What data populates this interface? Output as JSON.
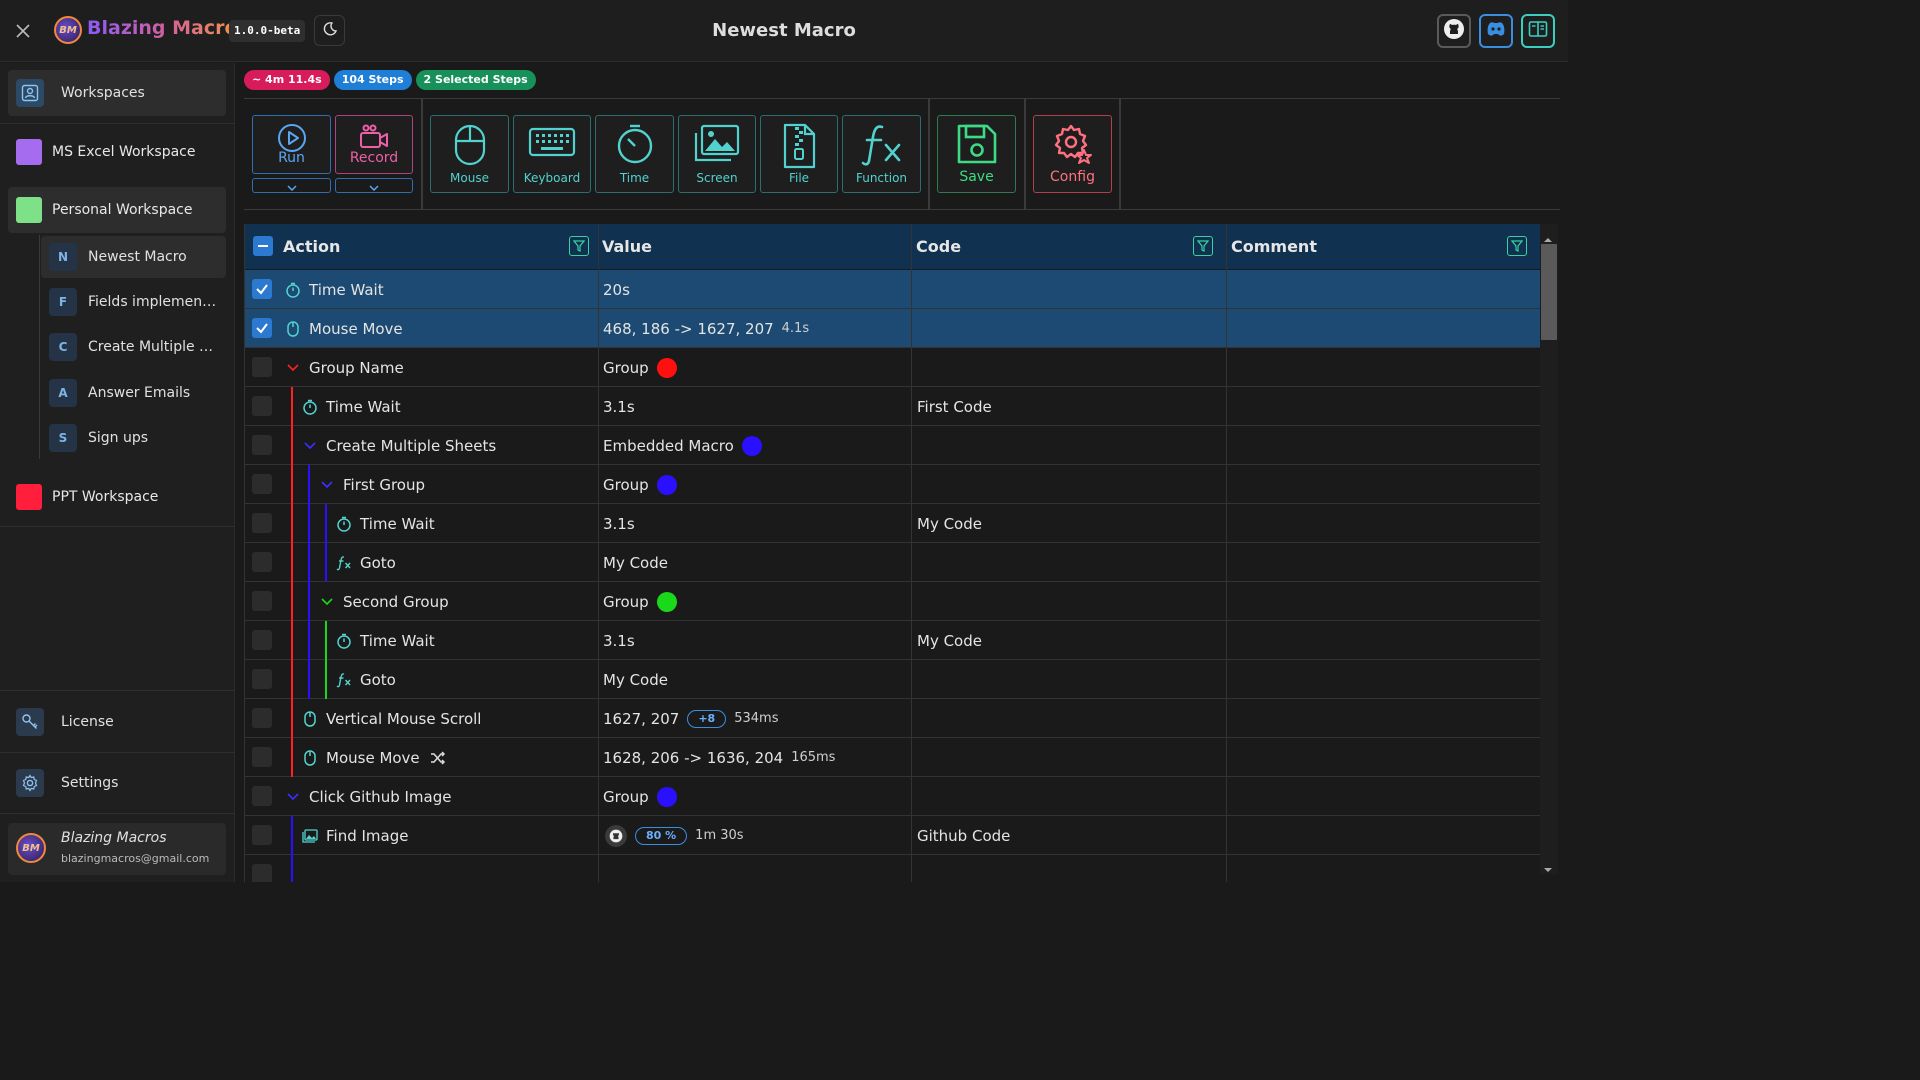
{
  "app": {
    "name": "Blazing Macros",
    "version": "1.0.0-beta",
    "window_title": "Newest Macro",
    "logo_text": "BM"
  },
  "sidebar": {
    "workspaces_label": "Workspaces",
    "workspaces": [
      {
        "label": "MS Excel Workspace",
        "color": "#a66cf0"
      },
      {
        "label": "Personal Workspace",
        "color": "#7ee087"
      },
      {
        "label": "PPT Workspace",
        "color": "#ff1e3c"
      }
    ],
    "macros": [
      {
        "letter": "N",
        "label": "Newest Macro"
      },
      {
        "letter": "F",
        "label": "Fields implementor"
      },
      {
        "letter": "C",
        "label": "Create Multiple Sheets"
      },
      {
        "letter": "A",
        "label": "Answer Emails"
      },
      {
        "letter": "S",
        "label": "Sign ups"
      }
    ],
    "license_label": "License",
    "settings_label": "Settings",
    "user": {
      "name": "Blazing Macros",
      "email": "blazingmacros@gmail.com"
    }
  },
  "badges": [
    {
      "label": "~ 4m 11.4s",
      "color": "#d81b5a"
    },
    {
      "label": "104 Steps",
      "color": "#1f7ed6"
    },
    {
      "label": "2 Selected Steps",
      "color": "#17905a"
    }
  ],
  "toolbar": {
    "run": "Run",
    "record": "Record",
    "mouse": "Mouse",
    "keyboard": "Keyboard",
    "time": "Time",
    "screen": "Screen",
    "file": "File",
    "function": "Function",
    "save": "Save",
    "config": "Config"
  },
  "table": {
    "headers": {
      "action": "Action",
      "value": "Value",
      "code": "Code",
      "comment": "Comment"
    },
    "rows": [
      {
        "action": "Time Wait",
        "value": "20s",
        "code": ""
      },
      {
        "action": "Mouse Move",
        "value": "468, 186 -> 1627, 207",
        "extra": "4.1s",
        "code": ""
      },
      {
        "action": "Group Name",
        "value": "Group",
        "code": ""
      },
      {
        "action": "Time Wait",
        "value": "3.1s",
        "code": "First Code"
      },
      {
        "action": "Create Multiple Sheets",
        "value": "Embedded Macro",
        "code": ""
      },
      {
        "action": "First Group",
        "value": "Group",
        "code": ""
      },
      {
        "action": "Time Wait",
        "value": "3.1s",
        "code": "My Code"
      },
      {
        "action": "Goto",
        "value": "My Code",
        "code": ""
      },
      {
        "action": "Second Group",
        "value": "Group",
        "code": ""
      },
      {
        "action": "Time Wait",
        "value": "3.1s",
        "code": "My Code"
      },
      {
        "action": "Goto",
        "value": "My Code",
        "code": ""
      },
      {
        "action": "Vertical Mouse Scroll",
        "value": "1627, 207",
        "pill": "+8",
        "extra": "534ms",
        "code": ""
      },
      {
        "action": "Mouse Move",
        "value": "1628, 206 -> 1636, 204",
        "extra": "165ms",
        "code": ""
      },
      {
        "action": "Click Github Image",
        "value": "Group",
        "code": ""
      },
      {
        "action": "Find Image",
        "value": "",
        "pill": "80 %",
        "extra": "1m 30s",
        "code": "Github Code"
      }
    ]
  },
  "colors": {
    "group_red": "#ff1010",
    "group_blue": "#2a10ff",
    "group_green": "#1ad81a",
    "accent_teal": "#52d2cf"
  }
}
